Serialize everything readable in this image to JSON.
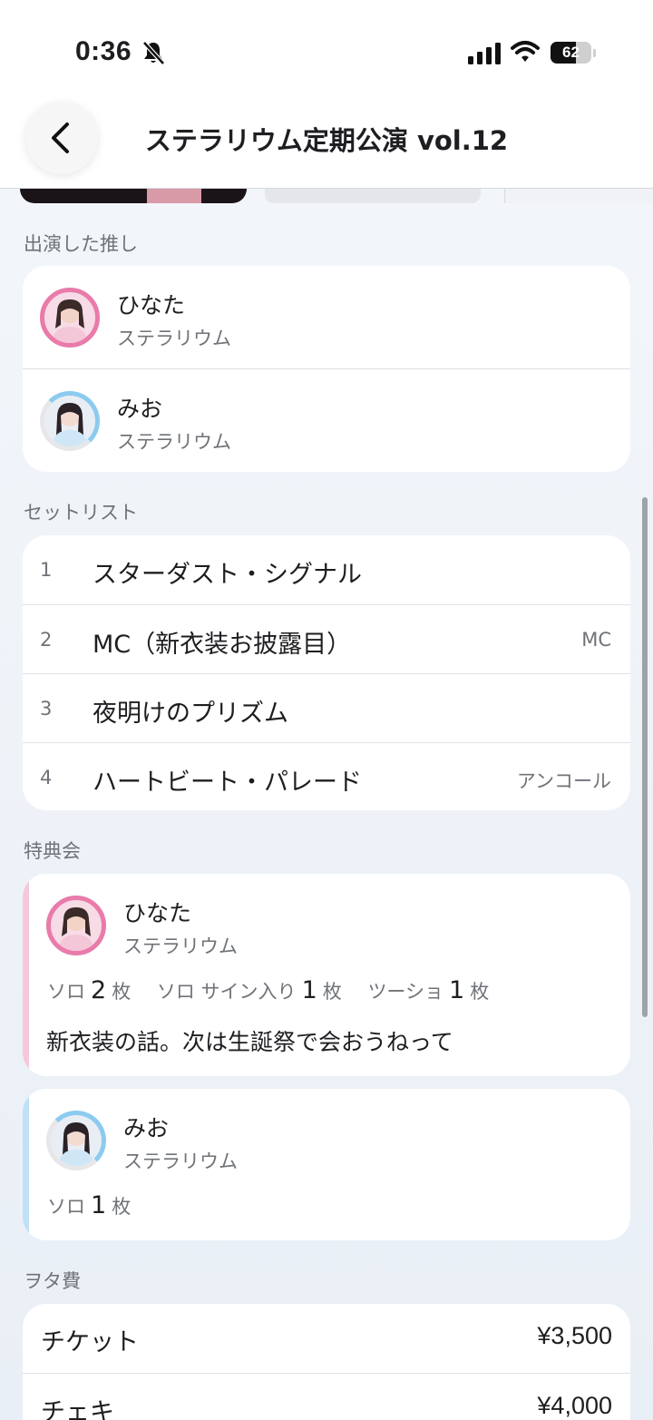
{
  "status_bar": {
    "time": "0:36",
    "battery_level": "62",
    "battery_fraction": 0.62,
    "icons": [
      "bell-slash-icon",
      "cellular-signal-icon",
      "wifi-icon",
      "battery-icon"
    ]
  },
  "header": {
    "title": "ステラリウム定期公演 vol.12",
    "back_icon": "chevron-left-icon"
  },
  "performers": {
    "label": "出演した推し",
    "items": [
      {
        "name": "ひなた",
        "group": "ステラリウム",
        "color": "#e97bab"
      },
      {
        "name": "みお",
        "group": "ステラリウム",
        "color": "#8ccbef"
      }
    ]
  },
  "setlist": {
    "label": "セットリスト",
    "items": [
      {
        "num": "1",
        "title": "スターダスト・シグナル",
        "tag": ""
      },
      {
        "num": "2",
        "title": "MC（新衣装お披露目）",
        "tag": "MC"
      },
      {
        "num": "3",
        "title": "夜明けのプリズム",
        "tag": ""
      },
      {
        "num": "4",
        "title": "ハートビート・パレード",
        "tag": "アンコール"
      }
    ]
  },
  "bonus": {
    "label": "特典会",
    "items": [
      {
        "name": "ひなた",
        "group": "ステラリウム",
        "stripe_color": "#f6c9da",
        "tickets": [
          {
            "type": "ソロ",
            "count": "2",
            "unit": "枚"
          },
          {
            "type": "ソロ サイン入り",
            "count": "1",
            "unit": "枚"
          },
          {
            "type": "ツーショ",
            "count": "1",
            "unit": "枚"
          }
        ],
        "memo": "新衣装の話。次は生誕祭で会おうねって"
      },
      {
        "name": "みお",
        "group": "ステラリウム",
        "stripe_color": "#bfe1f5",
        "tickets": [
          {
            "type": "ソロ",
            "count": "1",
            "unit": "枚"
          }
        ],
        "memo": ""
      }
    ]
  },
  "expenses": {
    "label": "ヲタ費",
    "items": [
      {
        "label": "チケット",
        "value": "¥3,500"
      },
      {
        "label": "チェキ",
        "value": "¥4,000"
      }
    ]
  }
}
